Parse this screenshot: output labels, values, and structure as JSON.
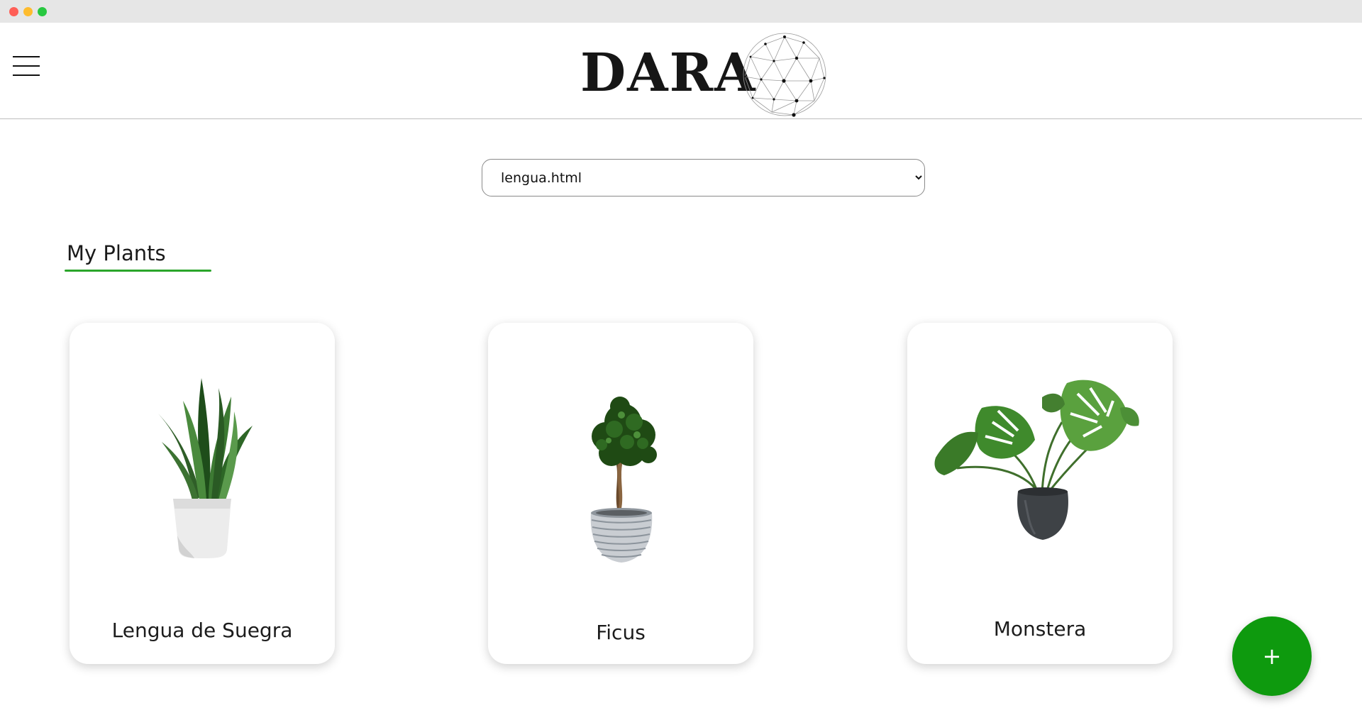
{
  "header": {
    "logo_text": "DARA",
    "menu_icon": "hamburger-icon",
    "logo_icon": "geodesic-globe-icon"
  },
  "page_select": {
    "selected": "lengua.html",
    "options": [
      "lengua.html"
    ]
  },
  "section": {
    "title": "My Plants",
    "accent_color": "#2aa52a"
  },
  "plants": [
    {
      "name": "Lengua de Suegra",
      "image": "snake-plant-image"
    },
    {
      "name": "Ficus",
      "image": "ficus-tree-image"
    },
    {
      "name": "Monstera",
      "image": "monstera-plant-image"
    }
  ],
  "fab": {
    "label": "+",
    "color": "#0e9a0e"
  }
}
